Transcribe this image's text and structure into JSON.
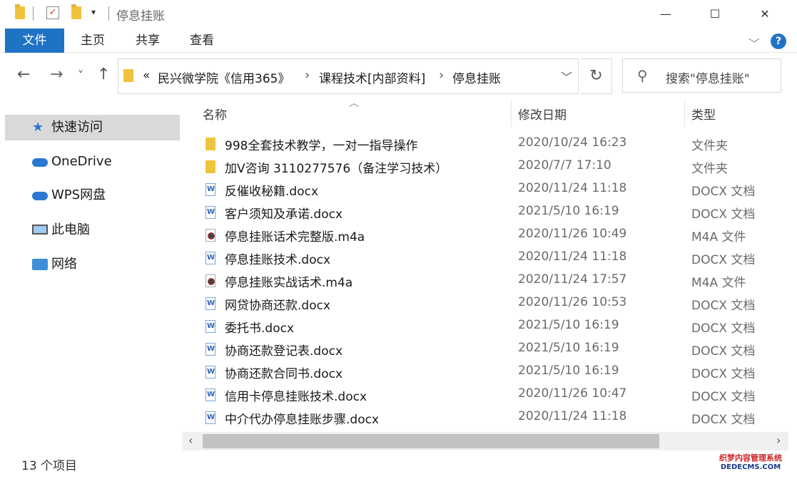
{
  "window": {
    "title": "停息挂账",
    "minimize_glyph": "—",
    "maximize_glyph": "☐",
    "close_glyph": "✕"
  },
  "ribbon": {
    "tabs": [
      "文件",
      "主页",
      "共享",
      "查看"
    ],
    "help_label": "?"
  },
  "nav": {
    "back_glyph": "←",
    "forward_glyph": "→",
    "recent_glyph": "˅",
    "up_glyph": "↑",
    "breadcrumb_overflow": "«",
    "breadcrumbs": [
      "民兴微学院《信用365》",
      "课程技术[内部资料]",
      "停息挂账"
    ],
    "crumb_separator": "›",
    "refresh_glyph": "↻",
    "search_placeholder": "搜索\"停息挂账\""
  },
  "sidebar": {
    "items": [
      {
        "label": "快速访问",
        "icon": "star-icon"
      },
      {
        "label": "OneDrive",
        "icon": "cloud-icon"
      },
      {
        "label": "WPS网盘",
        "icon": "cloud-icon"
      },
      {
        "label": "此电脑",
        "icon": "computer-icon"
      },
      {
        "label": "网络",
        "icon": "network-icon"
      }
    ]
  },
  "columns": {
    "name": "名称",
    "date": "修改日期",
    "type": "类型"
  },
  "files": [
    {
      "name": "998全套技术教学，一对一指导操作",
      "date": "2020/10/24 16:23",
      "type": "文件夹",
      "icon": "folder"
    },
    {
      "name": "加V咨询  3110277576（备注学习技术）",
      "date": "2020/7/7 17:10",
      "type": "文件夹",
      "icon": "folder"
    },
    {
      "name": "反催收秘籍.docx",
      "date": "2020/11/24 11:18",
      "type": "DOCX 文档",
      "icon": "doc"
    },
    {
      "name": "客户须知及承诺.docx",
      "date": "2021/5/10 16:19",
      "type": "DOCX 文档",
      "icon": "doc"
    },
    {
      "name": "停息挂账话术完整版.m4a",
      "date": "2020/11/26 10:49",
      "type": "M4A 文件",
      "icon": "audio"
    },
    {
      "name": "停息挂账技术.docx",
      "date": "2020/11/24 11:18",
      "type": "DOCX 文档",
      "icon": "doc"
    },
    {
      "name": "停息挂账实战话术.m4a",
      "date": "2020/11/24 17:57",
      "type": "M4A 文件",
      "icon": "audio"
    },
    {
      "name": "网贷协商还款.docx",
      "date": "2020/11/26 10:53",
      "type": "DOCX 文档",
      "icon": "doc"
    },
    {
      "name": "委托书.docx",
      "date": "2021/5/10 16:19",
      "type": "DOCX 文档",
      "icon": "doc"
    },
    {
      "name": "协商还款登记表.docx",
      "date": "2021/5/10 16:19",
      "type": "DOCX 文档",
      "icon": "doc"
    },
    {
      "name": "协商还款合同书.docx",
      "date": "2021/5/10 16:19",
      "type": "DOCX 文档",
      "icon": "doc"
    },
    {
      "name": "信用卡停息挂账技术.docx",
      "date": "2020/11/26 10:47",
      "type": "DOCX 文档",
      "icon": "doc"
    },
    {
      "name": "中介代办停息挂账步骤.docx",
      "date": "2020/11/24 11:18",
      "type": "DOCX 文档",
      "icon": "doc"
    }
  ],
  "status": {
    "item_count": "13 个项目"
  },
  "watermark": {
    "line1": "织梦内容管理系统",
    "line2": "DEDECMS.COM"
  },
  "colors": {
    "accent": "#1f73c5",
    "folder": "#f0c33c",
    "selection": "#d9d9d9"
  }
}
